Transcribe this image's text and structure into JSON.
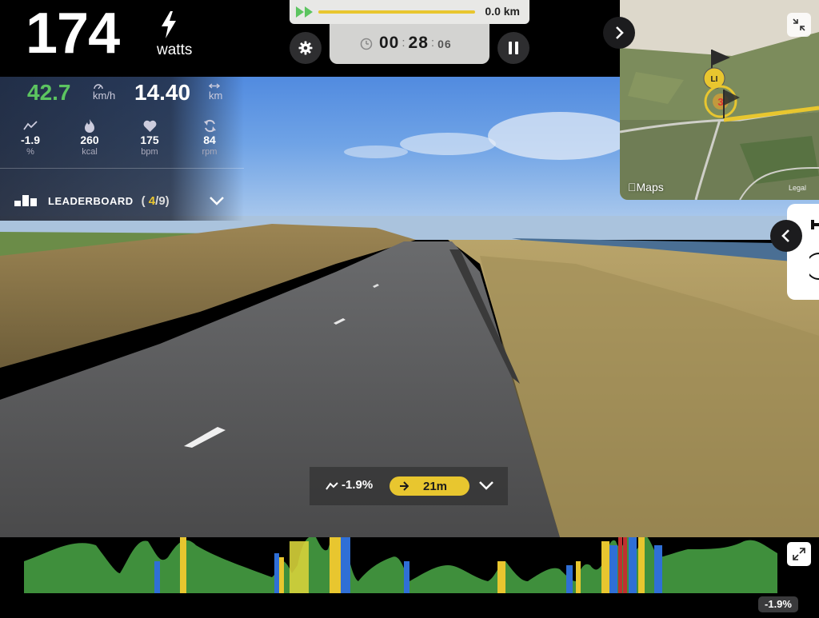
{
  "power": {
    "value": "174",
    "unit": "watts"
  },
  "progress": {
    "distance": "0.0 km",
    "fraction": 1.0
  },
  "timer": {
    "minutes": "00",
    "seconds": "28",
    "centiseconds": "06",
    "sep": ":"
  },
  "stats": {
    "speed": {
      "value": "42.7",
      "unit": "km/h"
    },
    "distance": {
      "value": "14.40",
      "unit": "km"
    },
    "metrics": [
      {
        "icon": "slope-icon",
        "value": "-1.9",
        "unit": "%"
      },
      {
        "icon": "flame-icon",
        "value": "260",
        "unit": "kcal"
      },
      {
        "icon": "heart-icon",
        "value": "175",
        "unit": "bpm"
      },
      {
        "icon": "cadence-icon",
        "value": "84",
        "unit": "rpm"
      }
    ]
  },
  "leaderboard": {
    "label": "LEADERBOARD",
    "open": "(",
    "position": "4",
    "slash": "/",
    "total": "9",
    "close": ")"
  },
  "map": {
    "credit": "Maps",
    "credit2": "Legal",
    "markers": [
      "LI",
      "3"
    ]
  },
  "slope_bar": {
    "grade": "-1.9%",
    "distance": "21m"
  },
  "elevation": {
    "grade": "-1.9%"
  },
  "colors": {
    "green": "#5cc460",
    "yellow": "#e8c62f",
    "blue": "#2f6fd6",
    "terrain": "#3f8f3c"
  }
}
